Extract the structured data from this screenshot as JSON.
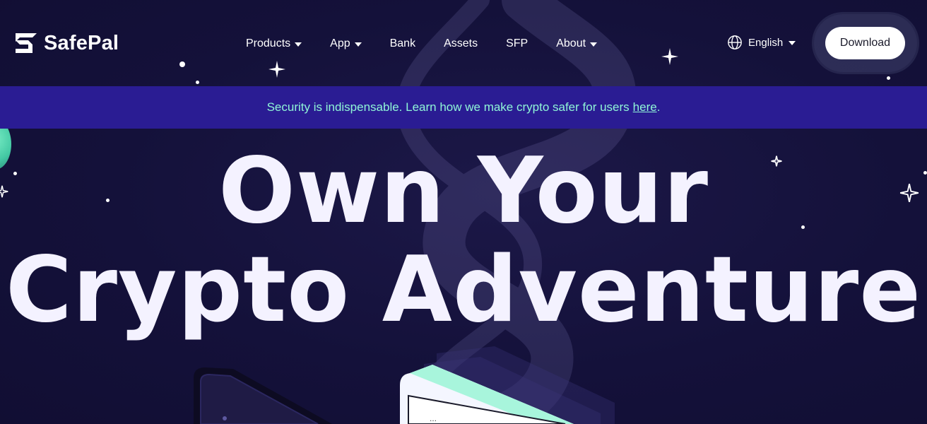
{
  "brand": {
    "name": "SafePal"
  },
  "nav": {
    "items": [
      {
        "label": "Products",
        "dropdown": true
      },
      {
        "label": "App",
        "dropdown": true
      },
      {
        "label": "Bank",
        "dropdown": false
      },
      {
        "label": "Assets",
        "dropdown": false
      },
      {
        "label": "SFP",
        "dropdown": false
      },
      {
        "label": "About",
        "dropdown": true
      }
    ]
  },
  "language": {
    "label": "English",
    "icon": "globe-icon"
  },
  "download": {
    "label": "Download"
  },
  "banner": {
    "text": "Security is indispensable. Learn how we make crypto safer for users",
    "link_label": "here",
    "suffix": "."
  },
  "hero": {
    "line1": "Own Your",
    "line2": "Crypto Adventure"
  },
  "colors": {
    "background": "#14113a",
    "banner_bg": "#2a1c93",
    "banner_text": "#8ff5d7",
    "hero_text": "#f4f2ff",
    "accent_mint": "#a8f5dc"
  }
}
